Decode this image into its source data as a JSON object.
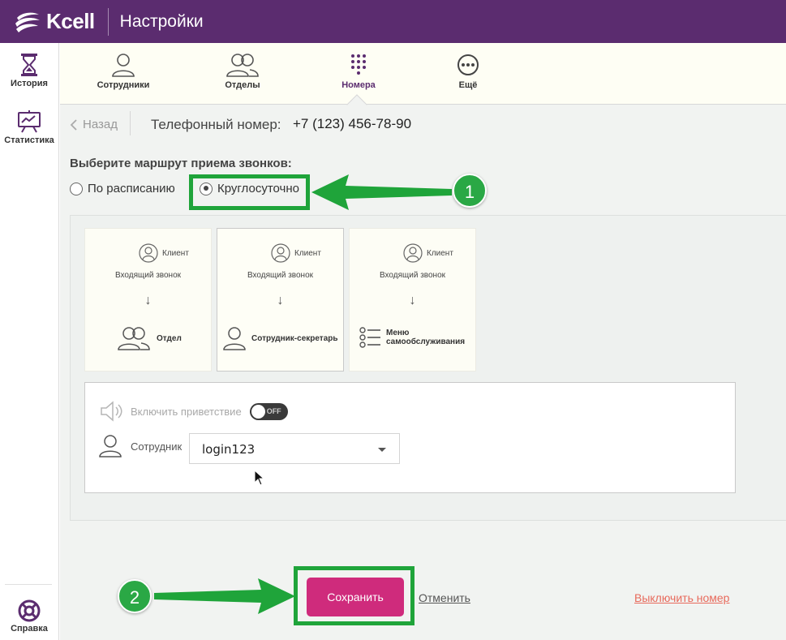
{
  "header": {
    "brand": "Kcell",
    "title": "Настройки"
  },
  "sidebar": {
    "items": [
      {
        "label": "История",
        "icon": "hourglass-icon"
      },
      {
        "label": "Статистика",
        "icon": "chart-board-icon"
      },
      {
        "label": "Справка",
        "icon": "lifebuoy-icon"
      }
    ]
  },
  "tabs": [
    {
      "label": "Сотрудники",
      "icon": "user-icon"
    },
    {
      "label": "Отделы",
      "icon": "users-icon"
    },
    {
      "label": "Номера",
      "icon": "keypad-icon",
      "active": true
    },
    {
      "label": "Ещё",
      "icon": "more-icon"
    }
  ],
  "back": {
    "label": "Назад"
  },
  "phone": {
    "label": "Телефонный номер:",
    "value": "+7 (123) 456-78-90"
  },
  "route": {
    "title": "Выберите маршрут приема звонков:",
    "options": [
      {
        "label": "По расписанию",
        "checked": false
      },
      {
        "label": "Круглосуточно",
        "checked": true
      }
    ]
  },
  "cards": [
    {
      "client": "Клиент",
      "incoming": "Входящий звонок",
      "arrow": "↓",
      "dest": "Отдел",
      "icon": "users-icon",
      "selected": false
    },
    {
      "client": "Клиент",
      "incoming": "Входящий звонок",
      "arrow": "↓",
      "dest": "Сотрудник-секретарь",
      "icon": "user-icon",
      "selected": true
    },
    {
      "client": "Клиент",
      "incoming": "Входящий звонок",
      "arrow": "↓",
      "dest_line1": "Меню",
      "dest_line2": "самообслуживания",
      "icon": "menu-list-icon",
      "selected": false
    }
  ],
  "settings": {
    "greeting_label": "Включить приветствие",
    "toggle_text": "OFF",
    "employee_label": "Сотрудник",
    "employee_value": "login123"
  },
  "actions": {
    "save": "Сохранить",
    "cancel": "Отменить",
    "disable": "Выключить номер"
  },
  "annotations": {
    "badge1": "1",
    "badge2": "2",
    "color": "#1fa43a"
  },
  "colors": {
    "header": "#5b2c6f",
    "save_button": "#cf2b7c",
    "disable_link": "#e86a5c"
  }
}
